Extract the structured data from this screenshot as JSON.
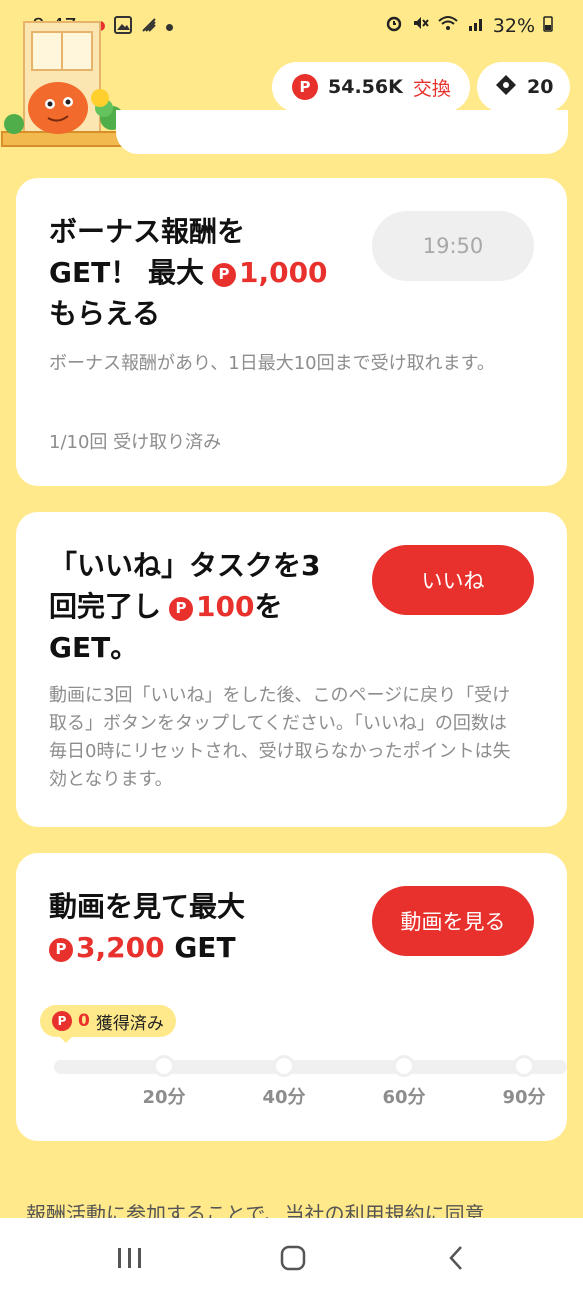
{
  "status_bar": {
    "time": "8:47",
    "battery": "32%"
  },
  "header": {
    "points_value": "54.56K",
    "exchange_label": "交換",
    "tickets_value": "20",
    "coin_glyph": "P"
  },
  "cards": {
    "bonus": {
      "title_line1": "ボーナス報酬を",
      "title_line2_prefix": "GET！ 最大",
      "title_amount": "1,000",
      "title_line3": "もらえる",
      "button_label": "19:50",
      "description": "ボーナス報酬があり、1日最大10回まで受け取れます。",
      "progress_text": "1/10回 受け取り済み"
    },
    "like_task": {
      "title_line1": "「いいね」タスクを3",
      "title_line2_prefix": "回完了し",
      "title_amount": "100",
      "title_line2_suffix": "を",
      "title_line3": "GET。",
      "button_label": "いいね",
      "description": "動画に3回「いいね」をした後、このページに戻り「受け取る」ボタンをタップしてください。「いいね」の回数は毎日0時にリセットされ、受け取らなかったポイントは失効となります。"
    },
    "watch": {
      "title_line1": "動画を見て最大",
      "title_amount": "3,200",
      "title_suffix": "GET",
      "button_label": "動画を見る",
      "earned_value": "0",
      "earned_label": "獲得済み",
      "milestones": [
        "20分",
        "40分",
        "60分",
        "90分"
      ],
      "progress_fraction": 0
    }
  },
  "footer": {
    "terms_text": "報酬活動に参加することで、当社の利用規約に同意"
  },
  "icons": {
    "mascot": "mascot-character-icon",
    "ticket": "ticket-icon",
    "nav_recent": "recent-apps-icon",
    "nav_home": "home-icon",
    "nav_back": "back-icon"
  },
  "colors": {
    "accent": "#e8312c",
    "background": "#ffe98a",
    "card": "#ffffff"
  }
}
